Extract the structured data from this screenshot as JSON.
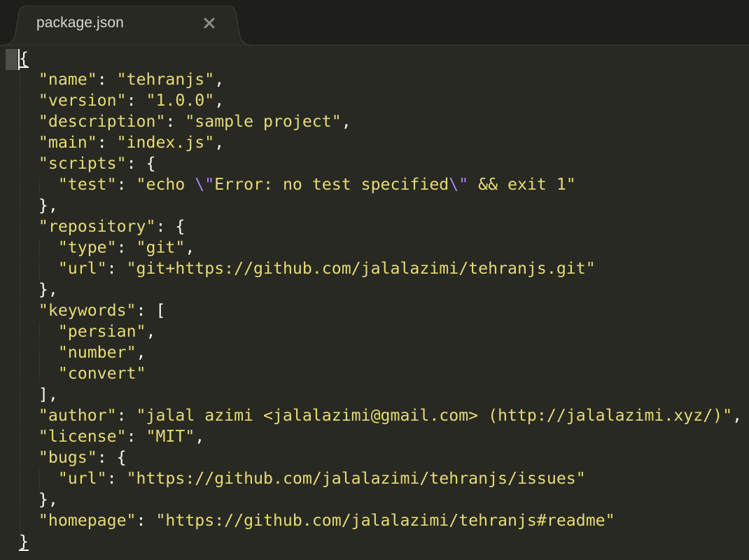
{
  "tab": {
    "title": "package.json",
    "close_icon": "close-icon"
  },
  "colors": {
    "background": "#282923",
    "string": "#e6db74",
    "punctuation": "#f8f8f2",
    "escape": "#ae81ff"
  },
  "code_lines": [
    {
      "segs": [
        {
          "t": "{",
          "c": "caret"
        }
      ]
    },
    {
      "segs": [
        {
          "t": "  ",
          "c": "p"
        },
        {
          "t": "\"name\"",
          "c": "s"
        },
        {
          "t": ": ",
          "c": "p"
        },
        {
          "t": "\"tehranjs\"",
          "c": "s"
        },
        {
          "t": ",",
          "c": "p"
        }
      ]
    },
    {
      "segs": [
        {
          "t": "  ",
          "c": "p"
        },
        {
          "t": "\"version\"",
          "c": "s"
        },
        {
          "t": ": ",
          "c": "p"
        },
        {
          "t": "\"1.0.0\"",
          "c": "s"
        },
        {
          "t": ",",
          "c": "p"
        }
      ]
    },
    {
      "segs": [
        {
          "t": "  ",
          "c": "p"
        },
        {
          "t": "\"description\"",
          "c": "s"
        },
        {
          "t": ": ",
          "c": "p"
        },
        {
          "t": "\"sample project\"",
          "c": "s"
        },
        {
          "t": ",",
          "c": "p"
        }
      ]
    },
    {
      "segs": [
        {
          "t": "  ",
          "c": "p"
        },
        {
          "t": "\"main\"",
          "c": "s"
        },
        {
          "t": ": ",
          "c": "p"
        },
        {
          "t": "\"index.js\"",
          "c": "s"
        },
        {
          "t": ",",
          "c": "p"
        }
      ]
    },
    {
      "segs": [
        {
          "t": "  ",
          "c": "p"
        },
        {
          "t": "\"scripts\"",
          "c": "s"
        },
        {
          "t": ": {",
          "c": "p"
        }
      ]
    },
    {
      "segs": [
        {
          "t": "    ",
          "c": "p"
        },
        {
          "t": "\"test\"",
          "c": "s"
        },
        {
          "t": ": ",
          "c": "p"
        },
        {
          "t": "\"echo ",
          "c": "s"
        },
        {
          "t": "\\\"",
          "c": "e"
        },
        {
          "t": "Error: no test specified",
          "c": "s"
        },
        {
          "t": "\\\"",
          "c": "e"
        },
        {
          "t": " && exit 1\"",
          "c": "s"
        }
      ]
    },
    {
      "segs": [
        {
          "t": "  },",
          "c": "p"
        }
      ]
    },
    {
      "segs": [
        {
          "t": "  ",
          "c": "p"
        },
        {
          "t": "\"repository\"",
          "c": "s"
        },
        {
          "t": ": {",
          "c": "p"
        }
      ]
    },
    {
      "segs": [
        {
          "t": "    ",
          "c": "p"
        },
        {
          "t": "\"type\"",
          "c": "s"
        },
        {
          "t": ": ",
          "c": "p"
        },
        {
          "t": "\"git\"",
          "c": "s"
        },
        {
          "t": ",",
          "c": "p"
        }
      ]
    },
    {
      "segs": [
        {
          "t": "    ",
          "c": "p"
        },
        {
          "t": "\"url\"",
          "c": "s"
        },
        {
          "t": ": ",
          "c": "p"
        },
        {
          "t": "\"git+https://github.com/jalalazimi/tehranjs.git\"",
          "c": "s"
        }
      ]
    },
    {
      "segs": [
        {
          "t": "  },",
          "c": "p"
        }
      ]
    },
    {
      "segs": [
        {
          "t": "  ",
          "c": "p"
        },
        {
          "t": "\"keywords\"",
          "c": "s"
        },
        {
          "t": ": [",
          "c": "p"
        }
      ]
    },
    {
      "segs": [
        {
          "t": "    ",
          "c": "p"
        },
        {
          "t": "\"persian\"",
          "c": "s"
        },
        {
          "t": ",",
          "c": "p"
        }
      ]
    },
    {
      "segs": [
        {
          "t": "    ",
          "c": "p"
        },
        {
          "t": "\"number\"",
          "c": "s"
        },
        {
          "t": ",",
          "c": "p"
        }
      ]
    },
    {
      "segs": [
        {
          "t": "    ",
          "c": "p"
        },
        {
          "t": "\"convert\"",
          "c": "s"
        }
      ]
    },
    {
      "segs": [
        {
          "t": "  ],",
          "c": "p"
        }
      ]
    },
    {
      "segs": [
        {
          "t": "  ",
          "c": "p"
        },
        {
          "t": "\"author\"",
          "c": "s"
        },
        {
          "t": ": ",
          "c": "p"
        },
        {
          "t": "\"jalal azimi <jalalazimi@gmail.com> (http://jalalazimi.xyz/)\"",
          "c": "s"
        },
        {
          "t": ",",
          "c": "p"
        }
      ]
    },
    {
      "segs": [
        {
          "t": "  ",
          "c": "p"
        },
        {
          "t": "\"license\"",
          "c": "s"
        },
        {
          "t": ": ",
          "c": "p"
        },
        {
          "t": "\"MIT\"",
          "c": "s"
        },
        {
          "t": ",",
          "c": "p"
        }
      ]
    },
    {
      "segs": [
        {
          "t": "  ",
          "c": "p"
        },
        {
          "t": "\"bugs\"",
          "c": "s"
        },
        {
          "t": ": {",
          "c": "p"
        }
      ]
    },
    {
      "segs": [
        {
          "t": "    ",
          "c": "p"
        },
        {
          "t": "\"url\"",
          "c": "s"
        },
        {
          "t": ": ",
          "c": "p"
        },
        {
          "t": "\"https://github.com/jalalazimi/tehranjs/issues\"",
          "c": "s"
        }
      ]
    },
    {
      "segs": [
        {
          "t": "  },",
          "c": "p"
        }
      ]
    },
    {
      "segs": [
        {
          "t": "  ",
          "c": "p"
        },
        {
          "t": "\"homepage\"",
          "c": "s"
        },
        {
          "t": ": ",
          "c": "p"
        },
        {
          "t": "\"https://github.com/jalalazimi/tehranjs#readme\"",
          "c": "s"
        }
      ]
    },
    {
      "segs": [
        {
          "t": "}",
          "c": "caret"
        }
      ]
    }
  ]
}
